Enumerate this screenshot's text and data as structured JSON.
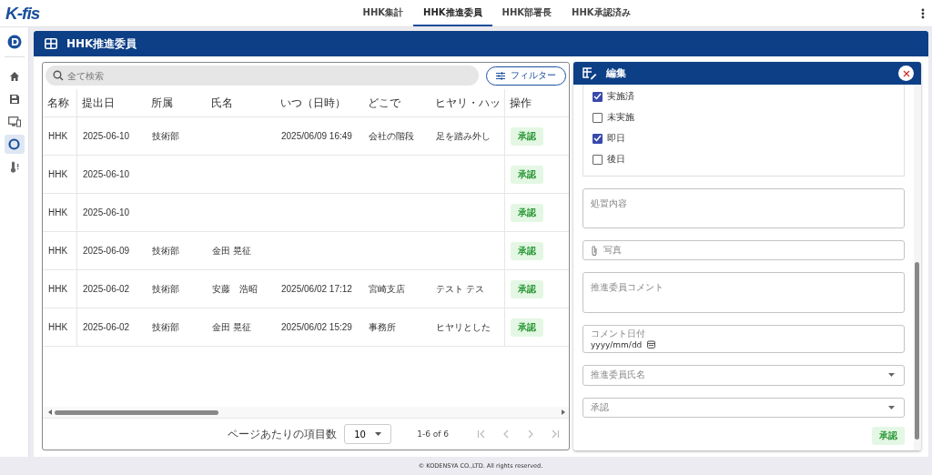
{
  "app": {
    "logo": "K-fis"
  },
  "tabs": [
    {
      "label": "HHK集計",
      "selected": false
    },
    {
      "label": "HHK推進委員",
      "selected": true
    },
    {
      "label": "HHK部署長",
      "selected": false
    },
    {
      "label": "HHK承認済み",
      "selected": false
    }
  ],
  "sidebar": {
    "items": [
      {
        "kind": "home",
        "selected": false
      },
      {
        "kind": "save",
        "selected": false
      },
      {
        "kind": "monitor",
        "selected": false
      },
      {
        "kind": "ring",
        "selected": true
      },
      {
        "kind": "thermometer",
        "selected": false
      }
    ]
  },
  "page": {
    "title": "HHK推進委員"
  },
  "search": {
    "placeholder": "全て検索"
  },
  "filter_button": "フィルター",
  "table": {
    "columns": [
      "名称",
      "提出日",
      "所属",
      "氏名",
      "いつ（日時）",
      "どこで",
      "ヒヤリ・ハッ",
      "操作"
    ],
    "rows": [
      {
        "cells": [
          "HHK",
          "2025-06-10",
          "技術部",
          "",
          "2025/06/09 16:49",
          "会社の階段",
          "足を踏み外し"
        ],
        "action": "承認"
      },
      {
        "cells": [
          "HHK",
          "2025-06-10",
          "",
          "",
          "",
          "",
          ""
        ],
        "action": "承認"
      },
      {
        "cells": [
          "HHK",
          "2025-06-10",
          "",
          "",
          "",
          "",
          ""
        ],
        "action": "承認"
      },
      {
        "cells": [
          "HHK",
          "2025-06-09",
          "技術部",
          "金田 晃征",
          "",
          "",
          ""
        ],
        "action": "承認"
      },
      {
        "cells": [
          "HHK",
          "2025-06-02",
          "技術部",
          "安藤　浩昭",
          "2025/06/02 17:12",
          "宮崎支店",
          "テスト テス"
        ],
        "action": "承認"
      },
      {
        "cells": [
          "HHK",
          "2025-06-02",
          "技術部",
          "金田 晃征",
          "2025/06/02 15:29",
          "事務所",
          "ヒヤリとした"
        ],
        "action": "承認"
      }
    ]
  },
  "pagination": {
    "per_page_label": "ページあたりの項目数",
    "per_page": "10",
    "range": "1-6 of 6"
  },
  "edit_panel": {
    "title": "編集",
    "checkboxes": [
      {
        "label": "実施済",
        "checked": true
      },
      {
        "label": "未実施",
        "checked": false
      },
      {
        "label": "即日",
        "checked": true
      },
      {
        "label": "後日",
        "checked": false
      }
    ],
    "fields": [
      {
        "kind": "textarea",
        "placeholder": "処置内容"
      },
      {
        "kind": "file",
        "placeholder": "写真"
      },
      {
        "kind": "textarea",
        "placeholder": "推進委員コメント"
      },
      {
        "kind": "date",
        "label": "コメント日付",
        "value": "yyyy/mm/dd"
      },
      {
        "kind": "select",
        "placeholder": "推進委員氏名"
      },
      {
        "kind": "select",
        "placeholder": "承認"
      }
    ],
    "submit": "承認"
  },
  "footer": "© KODENSYA CO.,LTD. All rights reserved."
}
